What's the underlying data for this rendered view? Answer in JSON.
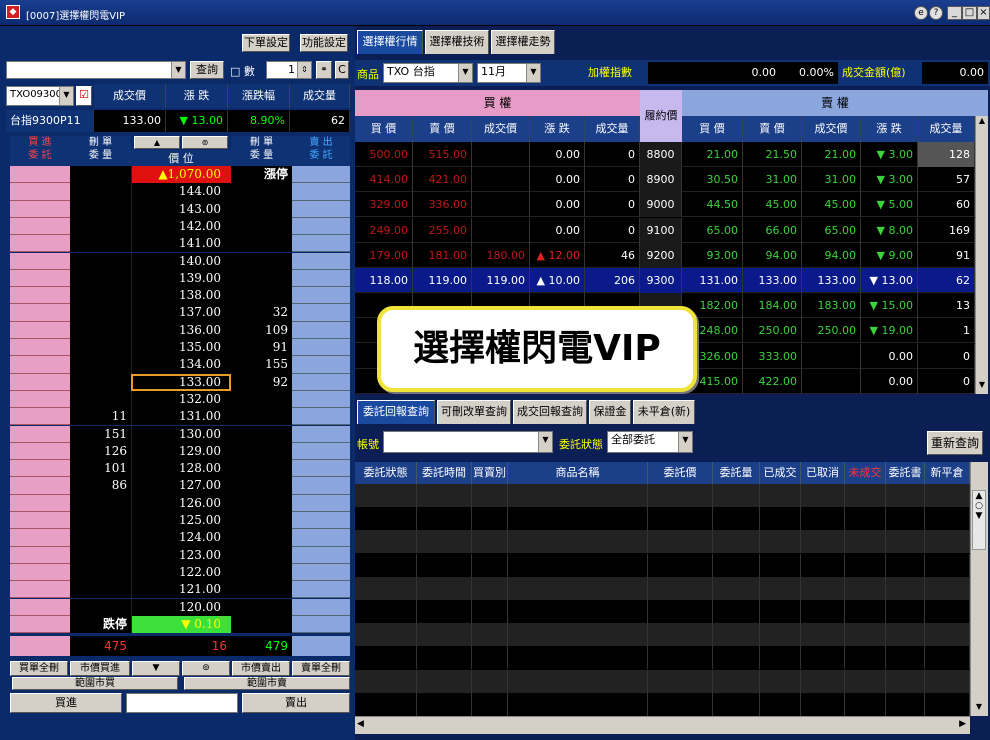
{
  "window": {
    "title": "[0007]選擇權閃電VIP",
    "help_icons": [
      "e-icon",
      "help-icon"
    ],
    "controls": [
      "_",
      "□",
      "×"
    ]
  },
  "left": {
    "order_setting_btn": "下單設定",
    "function_setting_btn": "功能設定",
    "query_btn": "查詢",
    "qty_label": "□ 數",
    "qty_value": "1",
    "c_btn": "C",
    "symbol": "TXO09300",
    "product_name": "台指9300P11",
    "quote_headers": [
      "成交價",
      "漲 跌",
      "漲跌幅",
      "成交量"
    ],
    "quote_values": {
      "price": "133.00",
      "change": "▼ 13.00",
      "pct": "8.90%",
      "volume": "62"
    },
    "ladder_headers": {
      "buy_order": "買 進\n委 託",
      "del_buy": "刪 單\n委 量",
      "price": "價 位",
      "del_sell": "刪 單\n委 量",
      "sell_order": "賣 出\n委 託",
      "up_btn": "▲",
      "center_btn": "⊚"
    },
    "ladder": [
      {
        "price": "▲1,070.00",
        "bid": "",
        "ask": "漲停",
        "type": "limit-up"
      },
      {
        "price": "144.00",
        "bid": "",
        "ask": ""
      },
      {
        "price": "143.00",
        "bid": "",
        "ask": ""
      },
      {
        "price": "142.00",
        "bid": "",
        "ask": ""
      },
      {
        "price": "141.00",
        "bid": "",
        "ask": ""
      },
      {
        "price": "140.00",
        "bid": "",
        "ask": ""
      },
      {
        "price": "139.00",
        "bid": "",
        "ask": ""
      },
      {
        "price": "138.00",
        "bid": "",
        "ask": ""
      },
      {
        "price": "137.00",
        "bid": "",
        "ask": "32"
      },
      {
        "price": "136.00",
        "bid": "",
        "ask": "109"
      },
      {
        "price": "135.00",
        "bid": "",
        "ask": "91"
      },
      {
        "price": "134.00",
        "bid": "",
        "ask": "155"
      },
      {
        "price": "133.00",
        "bid": "",
        "ask": "92",
        "type": "current"
      },
      {
        "price": "132.00",
        "bid": "",
        "ask": ""
      },
      {
        "price": "131.00",
        "bid": "11",
        "ask": ""
      },
      {
        "price": "130.00",
        "bid": "151",
        "ask": ""
      },
      {
        "price": "129.00",
        "bid": "126",
        "ask": ""
      },
      {
        "price": "128.00",
        "bid": "101",
        "ask": ""
      },
      {
        "price": "127.00",
        "bid": "86",
        "ask": ""
      },
      {
        "price": "126.00",
        "bid": "",
        "ask": ""
      },
      {
        "price": "125.00",
        "bid": "",
        "ask": ""
      },
      {
        "price": "124.00",
        "bid": "",
        "ask": ""
      },
      {
        "price": "123.00",
        "bid": "",
        "ask": ""
      },
      {
        "price": "122.00",
        "bid": "",
        "ask": ""
      },
      {
        "price": "121.00",
        "bid": "",
        "ask": ""
      },
      {
        "price": "120.00",
        "bid": "",
        "ask": ""
      },
      {
        "price": "▼   0.10",
        "bid": "跌停",
        "ask": "",
        "type": "limit-down"
      }
    ],
    "totals": {
      "buy": "475",
      "mid": "16",
      "sell": "479"
    },
    "bottom_buttons": [
      "買單全刪",
      "市價買進",
      "▼",
      "⊚",
      "市價賣出",
      "賣單全刪"
    ],
    "range_market_buy": "範圍市買",
    "range_market_sell": "範圍市賣",
    "buy_btn": "買進",
    "sell_btn": "賣出"
  },
  "right": {
    "tabs": [
      "選擇權行情",
      "選擇權技術",
      "選擇權走勢"
    ],
    "product_label": "商品",
    "product_value": "TXO 台指",
    "month_value": "11月",
    "index_label": "加權指數",
    "index_value": "0.00",
    "index_pct": "0.00%",
    "turnover_label": "成交金額(億)",
    "turnover_value": "0.00",
    "call_label": "買  權",
    "put_label": "賣  權",
    "strike_label": "履約價",
    "col_headers": [
      "買 價",
      "賣 價",
      "成交價",
      "漲 跌",
      "成交量"
    ],
    "rows": [
      {
        "cb": "500.00",
        "cs": "515.00",
        "cp": "",
        "cc": "0.00",
        "cv": "0",
        "k": "8800",
        "pb": "21.00",
        "ps": "21.50",
        "pp": "21.00",
        "pc": "▼  3.00",
        "pv": "128"
      },
      {
        "cb": "414.00",
        "cs": "421.00",
        "cp": "",
        "cc": "0.00",
        "cv": "0",
        "k": "8900",
        "pb": "30.50",
        "ps": "31.00",
        "pp": "31.00",
        "pc": "▼  3.00",
        "pv": "57"
      },
      {
        "cb": "329.00",
        "cs": "336.00",
        "cp": "",
        "cc": "0.00",
        "cv": "0",
        "k": "9000",
        "pb": "44.50",
        "ps": "45.00",
        "pp": "45.00",
        "pc": "▼  5.00",
        "pv": "60"
      },
      {
        "cb": "249.00",
        "cs": "255.00",
        "cp": "",
        "cc": "0.00",
        "cv": "0",
        "k": "9100",
        "pb": "65.00",
        "ps": "66.00",
        "pp": "65.00",
        "pc": "▼  8.00",
        "pv": "169"
      },
      {
        "cb": "179.00",
        "cs": "181.00",
        "cp": "180.00",
        "cc": "▲ 12.00",
        "cv": "46",
        "k": "9200",
        "pb": "93.00",
        "ps": "94.00",
        "pp": "94.00",
        "pc": "▼  9.00",
        "pv": "91"
      },
      {
        "cb": "118.00",
        "cs": "119.00",
        "cp": "119.00",
        "cc": "▲ 10.00",
        "cv": "206",
        "k": "9300",
        "pb": "131.00",
        "ps": "133.00",
        "pp": "133.00",
        "pc": "▼ 13.00",
        "pv": "62",
        "sel": true
      },
      {
        "cb": "",
        "cs": "",
        "cp": "",
        "cc": "",
        "cv": "",
        "k": "",
        "pb": "182.00",
        "ps": "184.00",
        "pp": "183.00",
        "pc": "▼ 15.00",
        "pv": "13"
      },
      {
        "cb": "",
        "cs": "",
        "cp": "",
        "cc": "",
        "cv": "",
        "k": "",
        "pb": "248.00",
        "ps": "250.00",
        "pp": "250.00",
        "pc": "▼ 19.00",
        "pv": "1"
      },
      {
        "cb": "",
        "cs": "",
        "cp": "",
        "cc": "",
        "cv": "",
        "k": "",
        "pb": "326.00",
        "ps": "333.00",
        "pp": "",
        "pc": "0.00",
        "pv": "0"
      },
      {
        "cb": "",
        "cs": "",
        "cp": "",
        "cc": "",
        "cv": "",
        "k": "",
        "pb": "415.00",
        "ps": "422.00",
        "pp": "",
        "pc": "0.00",
        "pv": "0"
      }
    ],
    "overlay_text": "選擇權閃電VIP",
    "bottom_tabs": [
      "委託回報查詢",
      "可刪改單查詢",
      "成交回報查詢",
      "保證金",
      "未平倉(新)"
    ],
    "account_label": "帳號",
    "status_label": "委託狀態",
    "status_value": "全部委託",
    "requery_btn": "重新查詢",
    "order_headers": [
      "委託狀態",
      "委託時間",
      "買賣別",
      "商品名稱",
      "委託價",
      "委託量",
      "已成交",
      "已取消",
      "未成交",
      "委託書",
      "新平倉"
    ]
  }
}
